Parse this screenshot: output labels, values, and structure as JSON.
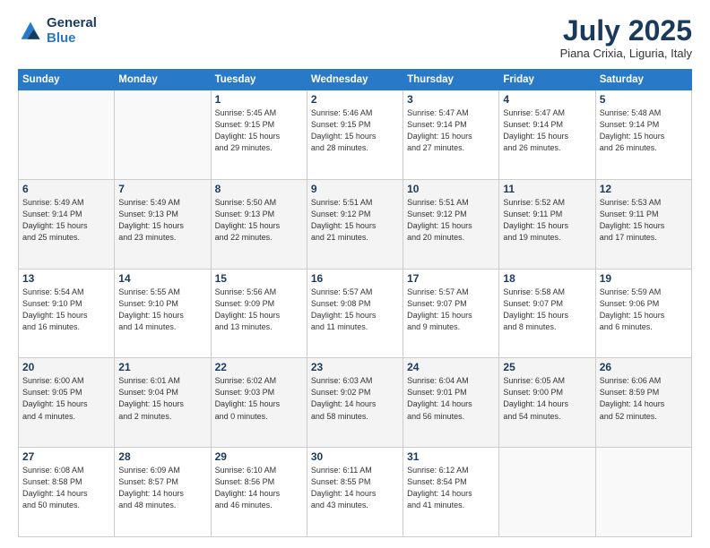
{
  "header": {
    "logo_line1": "General",
    "logo_line2": "Blue",
    "month_year": "July 2025",
    "location": "Piana Crixia, Liguria, Italy"
  },
  "days_of_week": [
    "Sunday",
    "Monday",
    "Tuesday",
    "Wednesday",
    "Thursday",
    "Friday",
    "Saturday"
  ],
  "weeks": [
    [
      {
        "num": "",
        "detail": ""
      },
      {
        "num": "",
        "detail": ""
      },
      {
        "num": "1",
        "detail": "Sunrise: 5:45 AM\nSunset: 9:15 PM\nDaylight: 15 hours\nand 29 minutes."
      },
      {
        "num": "2",
        "detail": "Sunrise: 5:46 AM\nSunset: 9:15 PM\nDaylight: 15 hours\nand 28 minutes."
      },
      {
        "num": "3",
        "detail": "Sunrise: 5:47 AM\nSunset: 9:14 PM\nDaylight: 15 hours\nand 27 minutes."
      },
      {
        "num": "4",
        "detail": "Sunrise: 5:47 AM\nSunset: 9:14 PM\nDaylight: 15 hours\nand 26 minutes."
      },
      {
        "num": "5",
        "detail": "Sunrise: 5:48 AM\nSunset: 9:14 PM\nDaylight: 15 hours\nand 26 minutes."
      }
    ],
    [
      {
        "num": "6",
        "detail": "Sunrise: 5:49 AM\nSunset: 9:14 PM\nDaylight: 15 hours\nand 25 minutes."
      },
      {
        "num": "7",
        "detail": "Sunrise: 5:49 AM\nSunset: 9:13 PM\nDaylight: 15 hours\nand 23 minutes."
      },
      {
        "num": "8",
        "detail": "Sunrise: 5:50 AM\nSunset: 9:13 PM\nDaylight: 15 hours\nand 22 minutes."
      },
      {
        "num": "9",
        "detail": "Sunrise: 5:51 AM\nSunset: 9:12 PM\nDaylight: 15 hours\nand 21 minutes."
      },
      {
        "num": "10",
        "detail": "Sunrise: 5:51 AM\nSunset: 9:12 PM\nDaylight: 15 hours\nand 20 minutes."
      },
      {
        "num": "11",
        "detail": "Sunrise: 5:52 AM\nSunset: 9:11 PM\nDaylight: 15 hours\nand 19 minutes."
      },
      {
        "num": "12",
        "detail": "Sunrise: 5:53 AM\nSunset: 9:11 PM\nDaylight: 15 hours\nand 17 minutes."
      }
    ],
    [
      {
        "num": "13",
        "detail": "Sunrise: 5:54 AM\nSunset: 9:10 PM\nDaylight: 15 hours\nand 16 minutes."
      },
      {
        "num": "14",
        "detail": "Sunrise: 5:55 AM\nSunset: 9:10 PM\nDaylight: 15 hours\nand 14 minutes."
      },
      {
        "num": "15",
        "detail": "Sunrise: 5:56 AM\nSunset: 9:09 PM\nDaylight: 15 hours\nand 13 minutes."
      },
      {
        "num": "16",
        "detail": "Sunrise: 5:57 AM\nSunset: 9:08 PM\nDaylight: 15 hours\nand 11 minutes."
      },
      {
        "num": "17",
        "detail": "Sunrise: 5:57 AM\nSunset: 9:07 PM\nDaylight: 15 hours\nand 9 minutes."
      },
      {
        "num": "18",
        "detail": "Sunrise: 5:58 AM\nSunset: 9:07 PM\nDaylight: 15 hours\nand 8 minutes."
      },
      {
        "num": "19",
        "detail": "Sunrise: 5:59 AM\nSunset: 9:06 PM\nDaylight: 15 hours\nand 6 minutes."
      }
    ],
    [
      {
        "num": "20",
        "detail": "Sunrise: 6:00 AM\nSunset: 9:05 PM\nDaylight: 15 hours\nand 4 minutes."
      },
      {
        "num": "21",
        "detail": "Sunrise: 6:01 AM\nSunset: 9:04 PM\nDaylight: 15 hours\nand 2 minutes."
      },
      {
        "num": "22",
        "detail": "Sunrise: 6:02 AM\nSunset: 9:03 PM\nDaylight: 15 hours\nand 0 minutes."
      },
      {
        "num": "23",
        "detail": "Sunrise: 6:03 AM\nSunset: 9:02 PM\nDaylight: 14 hours\nand 58 minutes."
      },
      {
        "num": "24",
        "detail": "Sunrise: 6:04 AM\nSunset: 9:01 PM\nDaylight: 14 hours\nand 56 minutes."
      },
      {
        "num": "25",
        "detail": "Sunrise: 6:05 AM\nSunset: 9:00 PM\nDaylight: 14 hours\nand 54 minutes."
      },
      {
        "num": "26",
        "detail": "Sunrise: 6:06 AM\nSunset: 8:59 PM\nDaylight: 14 hours\nand 52 minutes."
      }
    ],
    [
      {
        "num": "27",
        "detail": "Sunrise: 6:08 AM\nSunset: 8:58 PM\nDaylight: 14 hours\nand 50 minutes."
      },
      {
        "num": "28",
        "detail": "Sunrise: 6:09 AM\nSunset: 8:57 PM\nDaylight: 14 hours\nand 48 minutes."
      },
      {
        "num": "29",
        "detail": "Sunrise: 6:10 AM\nSunset: 8:56 PM\nDaylight: 14 hours\nand 46 minutes."
      },
      {
        "num": "30",
        "detail": "Sunrise: 6:11 AM\nSunset: 8:55 PM\nDaylight: 14 hours\nand 43 minutes."
      },
      {
        "num": "31",
        "detail": "Sunrise: 6:12 AM\nSunset: 8:54 PM\nDaylight: 14 hours\nand 41 minutes."
      },
      {
        "num": "",
        "detail": ""
      },
      {
        "num": "",
        "detail": ""
      }
    ]
  ]
}
